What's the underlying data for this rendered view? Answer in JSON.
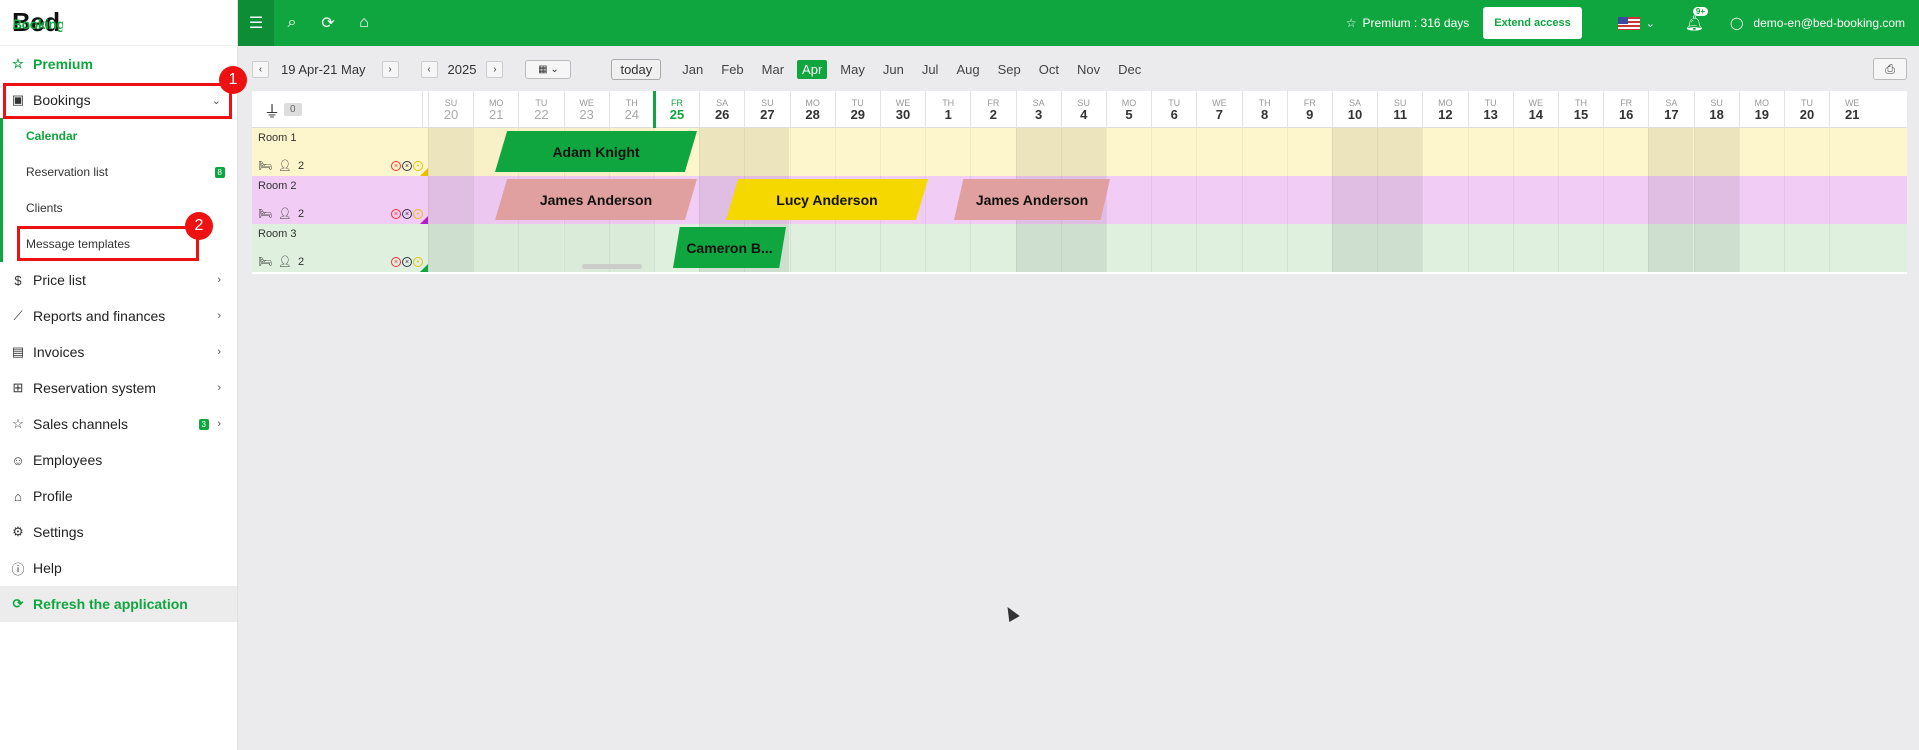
{
  "logo": {
    "part1": "Bed",
    "part2": "Booking"
  },
  "sidebar": {
    "premium": "Premium",
    "bookings": "Bookings",
    "sub": {
      "calendar": "Calendar",
      "reservation_list": "Reservation list",
      "reservation_badge": "8",
      "clients": "Clients",
      "message_templates": "Message templates"
    },
    "price_list": "Price list",
    "reports": "Reports and finances",
    "invoices": "Invoices",
    "reservation_system": "Reservation system",
    "sales_channels": "Sales channels",
    "sales_badge": "3",
    "employees": "Employees",
    "profile": "Profile",
    "settings": "Settings",
    "help": "Help",
    "refresh": "Refresh the application",
    "callouts": [
      "1",
      "2"
    ]
  },
  "topbar": {
    "premium_text": "Premium : 316 days",
    "extend_label": "Extend access",
    "notif_count": "9+",
    "user_email": "demo-en@bed-booking.com"
  },
  "toolbar": {
    "date_range": "19 Apr-21 May",
    "year": "2025",
    "today_label": "today",
    "months": [
      "Jan",
      "Feb",
      "Mar",
      "Apr",
      "May",
      "Jun",
      "Jul",
      "Aug",
      "Sep",
      "Oct",
      "Nov",
      "Dec"
    ],
    "active_month": "Apr"
  },
  "calendar": {
    "filter_count": "0",
    "days": [
      {
        "dn": "SU",
        "dd": "20",
        "past": true
      },
      {
        "dn": "MO",
        "dd": "21",
        "past": true
      },
      {
        "dn": "TU",
        "dd": "22",
        "past": true
      },
      {
        "dn": "WE",
        "dd": "23",
        "past": true
      },
      {
        "dn": "TH",
        "dd": "24",
        "past": true
      },
      {
        "dn": "FR",
        "dd": "25",
        "today": true
      },
      {
        "dn": "SA",
        "dd": "26"
      },
      {
        "dn": "SU",
        "dd": "27"
      },
      {
        "dn": "MO",
        "dd": "28"
      },
      {
        "dn": "TU",
        "dd": "29"
      },
      {
        "dn": "WE",
        "dd": "30"
      },
      {
        "dn": "TH",
        "dd": "1"
      },
      {
        "dn": "FR",
        "dd": "2"
      },
      {
        "dn": "SA",
        "dd": "3"
      },
      {
        "dn": "SU",
        "dd": "4"
      },
      {
        "dn": "MO",
        "dd": "5"
      },
      {
        "dn": "TU",
        "dd": "6"
      },
      {
        "dn": "WE",
        "dd": "7"
      },
      {
        "dn": "TH",
        "dd": "8"
      },
      {
        "dn": "FR",
        "dd": "9"
      },
      {
        "dn": "SA",
        "dd": "10"
      },
      {
        "dn": "SU",
        "dd": "11"
      },
      {
        "dn": "MO",
        "dd": "12"
      },
      {
        "dn": "TU",
        "dd": "13"
      },
      {
        "dn": "WE",
        "dd": "14"
      },
      {
        "dn": "TH",
        "dd": "15"
      },
      {
        "dn": "FR",
        "dd": "16"
      },
      {
        "dn": "SA",
        "dd": "17"
      },
      {
        "dn": "SU",
        "dd": "18"
      },
      {
        "dn": "MO",
        "dd": "19"
      },
      {
        "dn": "TU",
        "dd": "20"
      },
      {
        "dn": "WE",
        "dd": "21"
      }
    ],
    "rooms": [
      {
        "name": "Room 1",
        "capacity": "2",
        "color": "#fdf6cc",
        "corner": "#e8c000"
      },
      {
        "name": "Room 2",
        "capacity": "2",
        "color": "#f1ccf5",
        "corner": "#b020c8"
      },
      {
        "name": "Room 3",
        "capacity": "2",
        "color": "#dff0df",
        "corner": "#10a63f"
      }
    ],
    "bookings": [
      {
        "room": 0,
        "guest": "Adam Knight",
        "color": "#10a63f"
      },
      {
        "room": 1,
        "guest": "James Anderson",
        "color": "#e0a0a0"
      },
      {
        "room": 1,
        "guest": "Lucy Anderson",
        "color": "#f5d800"
      },
      {
        "room": 1,
        "guest": "James Anderson",
        "color": "#e0a0a0"
      },
      {
        "room": 2,
        "guest": "Cameron B...",
        "color": "#10a63f"
      }
    ]
  }
}
